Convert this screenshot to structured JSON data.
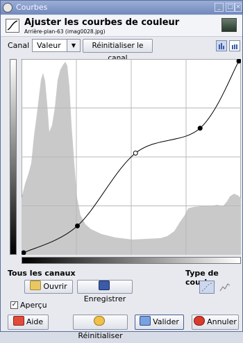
{
  "window": {
    "title": "Courbes"
  },
  "header": {
    "title": "Ajuster les courbes de couleur",
    "subtitle": "Arrière-plan-63 (imag0028.jpg)"
  },
  "channel": {
    "label": "Canal :",
    "value": "Valeur",
    "reset_label": "Réinitialiser le canal"
  },
  "sections": {
    "all_channels": "Tous les canaux",
    "curve_type": "Type de courbe"
  },
  "buttons": {
    "open": "Ouvrir",
    "save": "Enregistrer",
    "help": "Aide",
    "reset": "Réinitialiser",
    "validate": "Valider",
    "cancel": "Annuler"
  },
  "preview": {
    "label": "Aperçu",
    "checked": true
  },
  "colors": {
    "histogram": "#c9c9c9",
    "grid": "#b8b8b8",
    "curve": "#000000",
    "titlebar": "#8399c9"
  },
  "curve_points": [
    [
      0,
      0
    ],
    [
      0.25,
      0.14
    ],
    [
      0.52,
      0.52
    ],
    [
      0.82,
      0.65
    ],
    [
      1,
      1
    ]
  ],
  "selected_point": 2
}
